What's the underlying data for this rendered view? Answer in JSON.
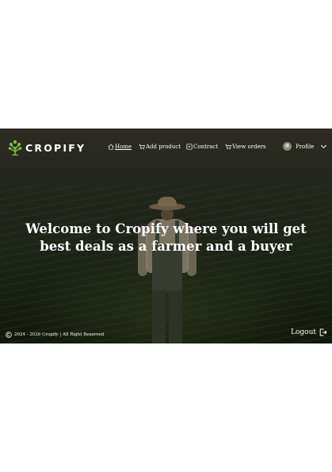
{
  "brand": {
    "name": "CROPIFY",
    "accent": "#7bc043"
  },
  "nav": {
    "links": [
      {
        "label": "Home",
        "icon": "home-icon",
        "active": true
      },
      {
        "label": "Add product",
        "icon": "cart-icon",
        "active": false
      },
      {
        "label": "Contract",
        "icon": "contract-icon",
        "active": false
      },
      {
        "label": "View orders",
        "icon": "cart-icon",
        "active": false
      }
    ],
    "profile_label": "Profile"
  },
  "hero": {
    "line1": "Welcome to Cropify where you will get",
    "line2": "best deals as a farmer and a buyer"
  },
  "footer": {
    "copyright": "2024 - 2026 Cropify | All Right Reserved",
    "logout_label": "Logout"
  }
}
